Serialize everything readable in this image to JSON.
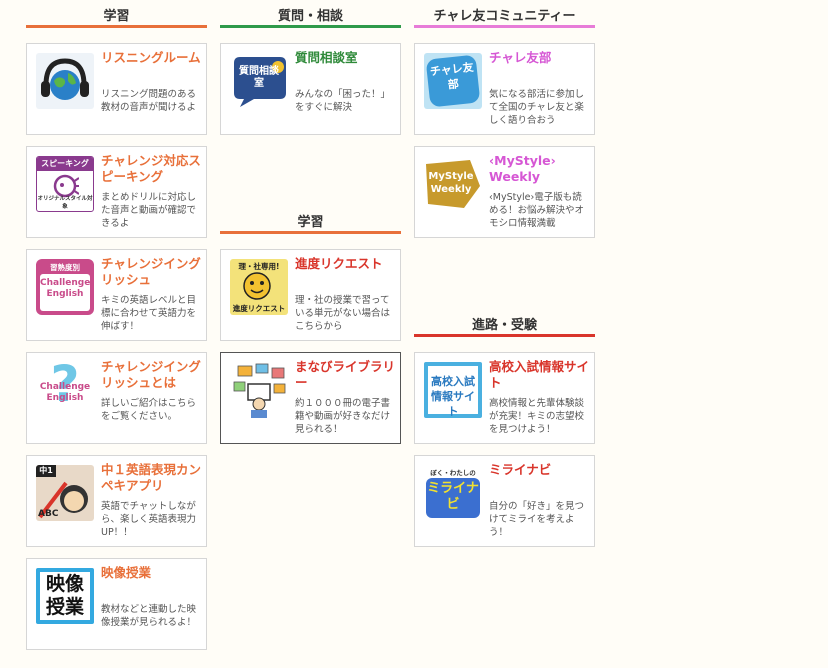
{
  "columns": [
    {
      "sections": [
        {
          "heading": "学習",
          "cards": [
            {
              "title": "リスニングルーム",
              "desc": "リスニング問題のある教材の音声が聞けるよ"
            },
            {
              "title": "チャレンジ対応スピーキング",
              "desc": "まとめドリルに対応した音声と動画が確認できるよ",
              "thumb_text": "スピーキング",
              "thumb_sub": "オリジナルスタイル対象"
            },
            {
              "title": "チャレンジイングリッシュ",
              "desc": "キミの英語レベルと目標に合わせて英語力を伸ばす！",
              "thumb_text": "習熟度別",
              "thumb_sub": "Challenge English"
            },
            {
              "title": "チャレンジイングリッシュとは",
              "desc": "詳しいご紹介はこちらをご覧ください。",
              "thumb_text": "Challenge English"
            },
            {
              "title": "中１英語表現カンペキアプリ",
              "desc": "英語でチャットしながら、楽しく英語表現力UP！！",
              "thumb_text": "中1",
              "thumb_sub": "ABC"
            },
            {
              "title": "映像授業",
              "desc": "教材などと連動した映像授業が見られるよ！",
              "thumb_text": "映像授業"
            }
          ]
        }
      ]
    },
    {
      "sections": [
        {
          "heading": "質問・相談",
          "cards": [
            {
              "title": "質問相談室",
              "desc": "みんなの「困った！」をすぐに解決",
              "thumb_text": "質問相談室"
            }
          ]
        },
        {
          "heading": "学習",
          "cards": [
            {
              "title": "進度リクエスト",
              "desc": "理・社の授業で習っている単元がない場合はこちらから",
              "thumb_text": "理・社専用!",
              "thumb_sub": "進度リクエスト"
            },
            {
              "title": "まなびライブラリー",
              "desc": "約１０００冊の電子書籍や動画が好きなだけ見られる！"
            }
          ]
        }
      ]
    },
    {
      "sections": [
        {
          "heading": "チャレ友コミュニティー",
          "cards": [
            {
              "title": "チャレ友部",
              "desc": "気になる部活に参加して全国のチャレ友と楽しく語り合おう",
              "thumb_text": "チャレ友部"
            },
            {
              "title": "‹MyStyle› Weekly",
              "desc": "‹MyStyle›電子版も読める！お悩み解決やオモシロ情報満載",
              "thumb_text": "MyStyle Weekly"
            }
          ]
        },
        {
          "heading": "進路・受験",
          "cards": [
            {
              "title": "高校入試情報サイト",
              "desc": "高校情報と先輩体験談が充実！キミの志望校を見つけよう！",
              "thumb_text": "高校入試情報サイト"
            },
            {
              "title": "ミライナビ",
              "desc": "自分の「好き」を見つけてミライを考えよう！",
              "thumb_text": "ぼく・わたしの",
              "thumb_sub": "ミライナビ"
            }
          ]
        }
      ]
    }
  ],
  "colors": {
    "accent_orange": "#e8703a",
    "accent_green": "#2f9a4a",
    "accent_pink": "#e77cd8",
    "title_pink": "#d657d4",
    "title_red": "#d9352b"
  }
}
